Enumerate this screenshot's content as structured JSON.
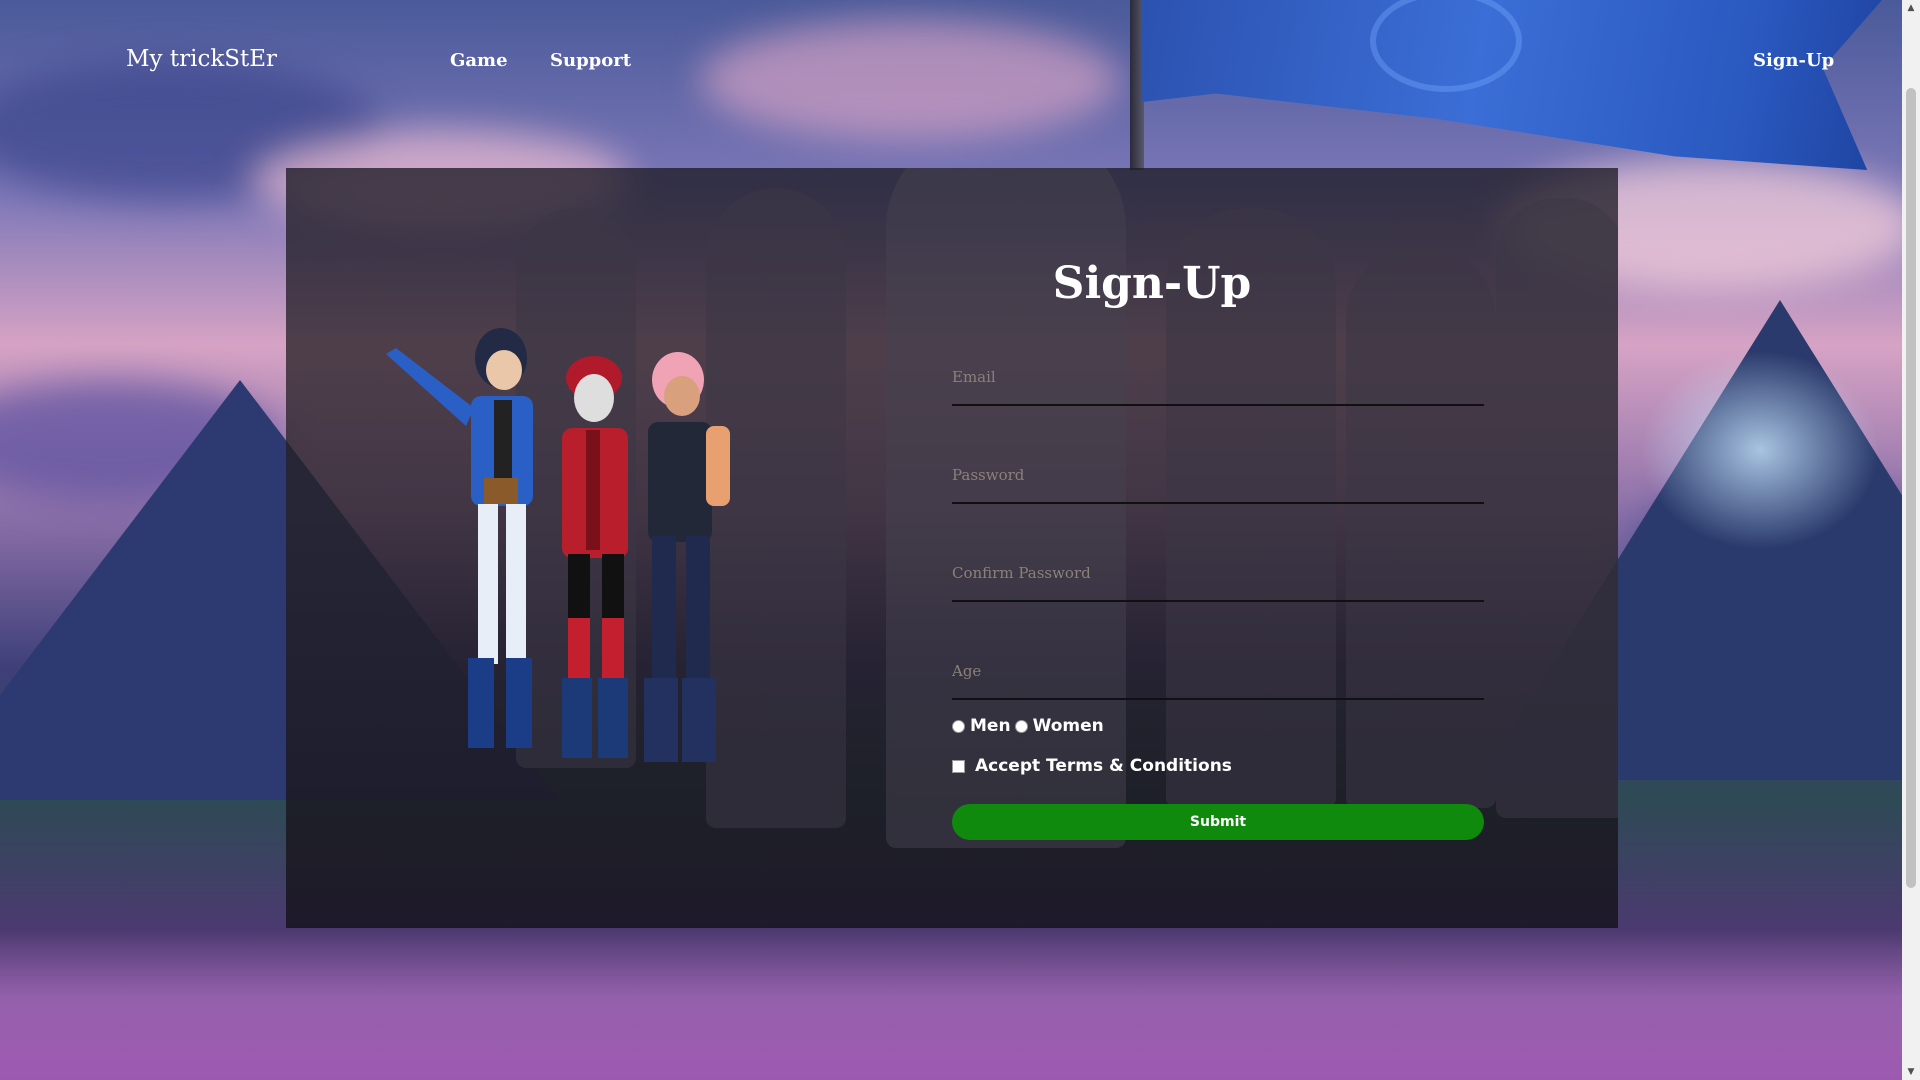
{
  "nav": {
    "brand": "My trickStEr",
    "links": [
      "Game",
      "Support"
    ],
    "signup": "Sign-Up"
  },
  "form": {
    "title": "Sign-Up",
    "email_placeholder": "Email",
    "password_placeholder": "Password",
    "confirm_placeholder": "Confirm Password",
    "age_placeholder": "Age",
    "gender_options": [
      "Men",
      "Women"
    ],
    "terms_label": "Accept Terms & Conditions",
    "submit_label": "Submit"
  },
  "colors": {
    "submit_bg": "#0f8a0c",
    "panel_bg": "#1e1c26",
    "flag": "#2c52b0"
  },
  "icons": {
    "scroll_up": "scroll-up-arrow-icon",
    "scroll_down": "scroll-down-arrow-icon"
  }
}
